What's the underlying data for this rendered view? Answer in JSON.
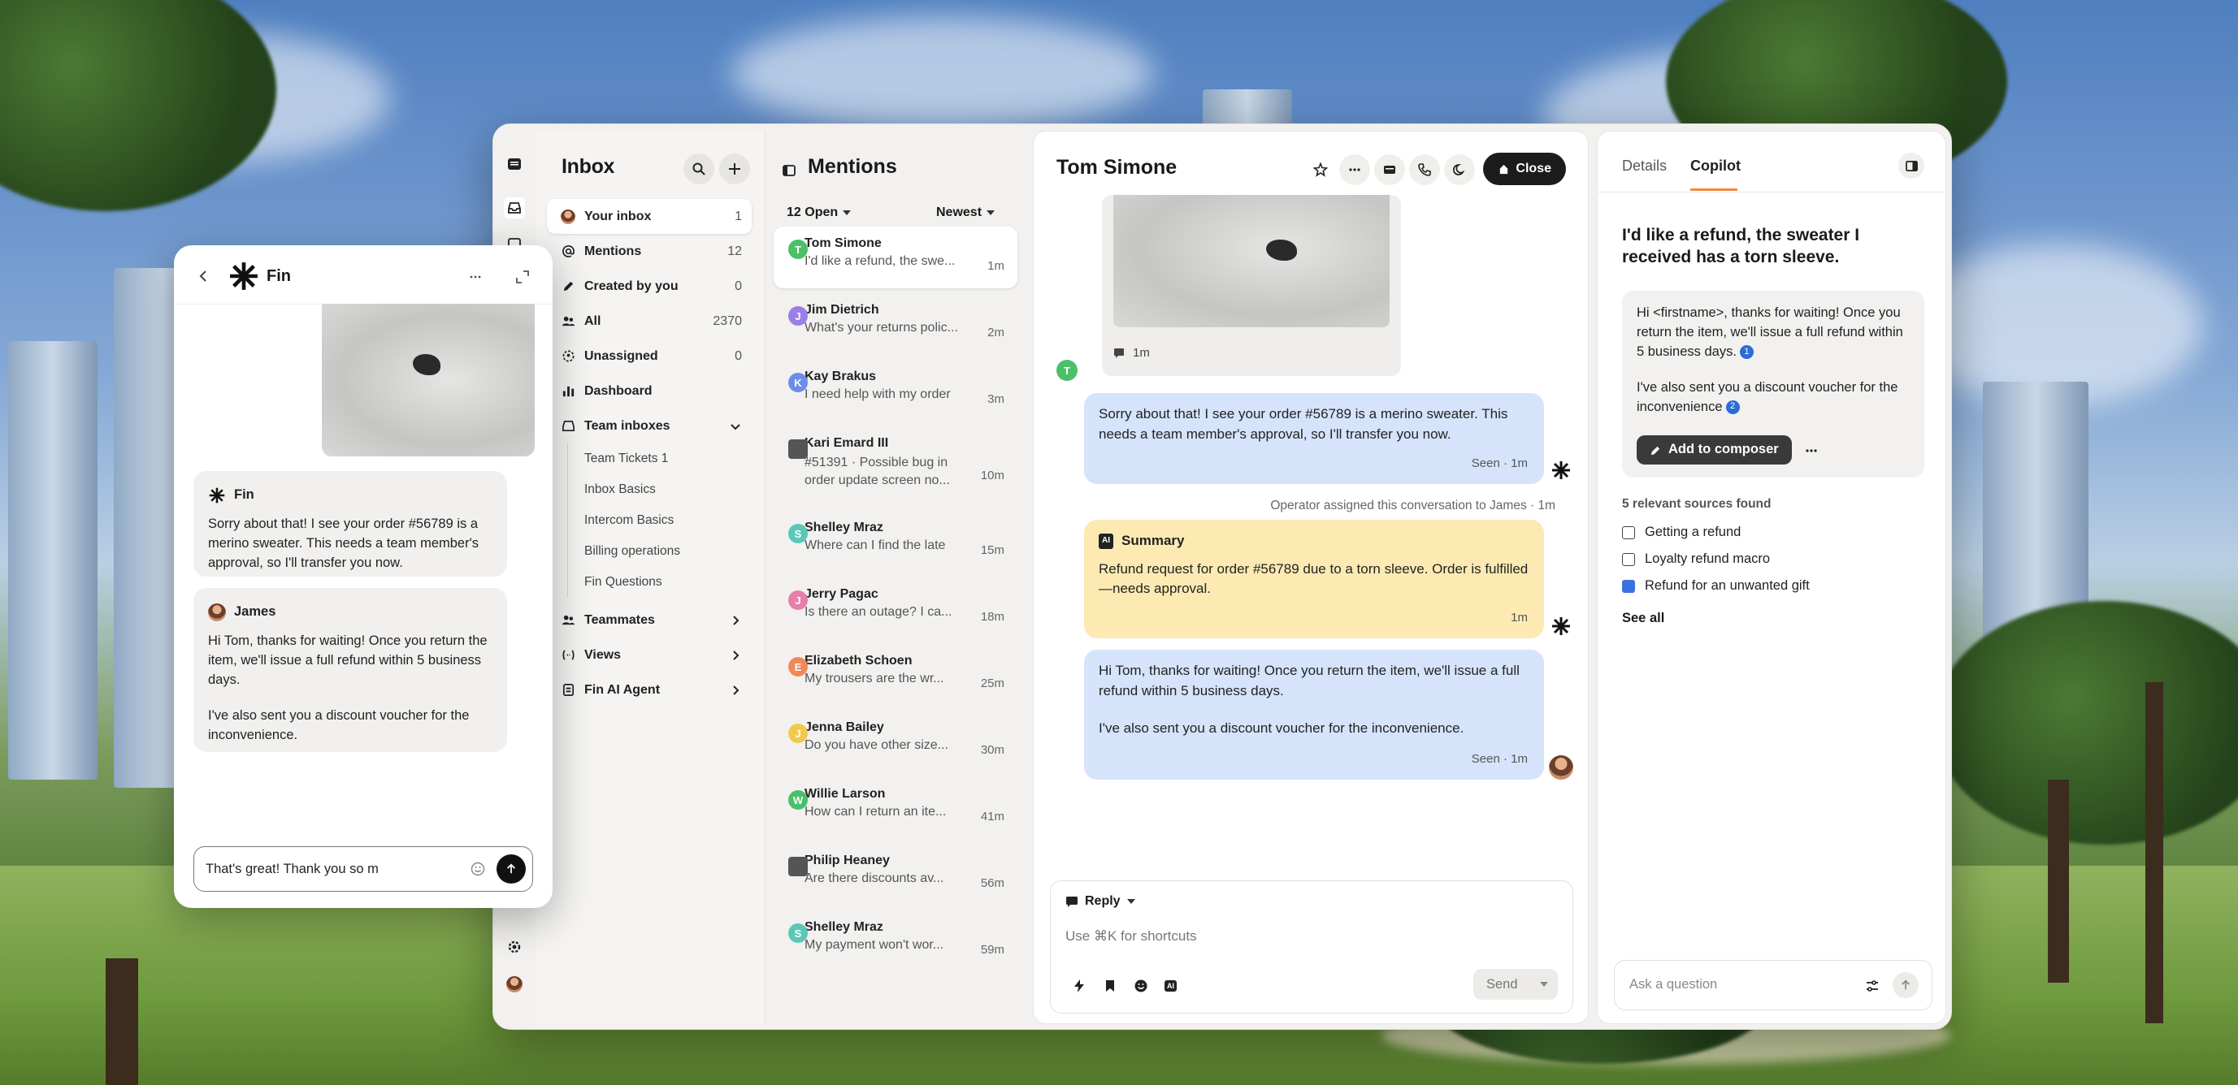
{
  "inbox": {
    "title": "Inbox",
    "nav": [
      {
        "label": "Your inbox",
        "count": "1"
      },
      {
        "label": "Mentions",
        "count": "12"
      },
      {
        "label": "Created by you",
        "count": "0"
      },
      {
        "label": "All",
        "count": "2370"
      },
      {
        "label": "Unassigned",
        "count": "0"
      },
      {
        "label": "Dashboard",
        "count": ""
      }
    ],
    "team_inboxes_label": "Team inboxes",
    "team_inboxes": [
      "Team Tickets 1",
      "Inbox Basics",
      "Intercom Basics",
      "Billing operations",
      "Fin Questions"
    ],
    "teammates_label": "Teammates",
    "views_label": "Views",
    "fin_ai_agent_label": "Fin AI Agent"
  },
  "mentions": {
    "title": "Mentions",
    "filter_status": "12 Open",
    "filter_sort": "Newest",
    "conversations": [
      {
        "initial": "T",
        "name": "Tom Simone",
        "preview": "I'd like a refund, the swe...",
        "time": "1m",
        "color": "#4cbf6a"
      },
      {
        "initial": "J",
        "name": "Jim Dietrich",
        "preview": "What's your returns polic...",
        "time": "2m",
        "color": "#9b7fe6"
      },
      {
        "initial": "K",
        "name": "Kay Brakus",
        "preview": "I need help with my order",
        "time": "3m",
        "color": "#6b8fe6"
      },
      {
        "initial": "",
        "name": "Kari Emard III",
        "preview": "#51391 · Possible bug in order update screen no...",
        "time": "10m",
        "color": "#555555"
      },
      {
        "initial": "S",
        "name": "Shelley Mraz",
        "preview": "Where can I find the late",
        "time": "15m",
        "color": "#5bc8b7"
      },
      {
        "initial": "J",
        "name": "Jerry Pagac",
        "preview": "Is there an outage? I ca...",
        "time": "18m",
        "color": "#e67fa9"
      },
      {
        "initial": "E",
        "name": "Elizabeth Schoen",
        "preview": "My trousers are the wr...",
        "time": "25m",
        "color": "#ef8a58"
      },
      {
        "initial": "J",
        "name": "Jenna Bailey",
        "preview": "Do you have other size...",
        "time": "30m",
        "color": "#f2c94c"
      },
      {
        "initial": "W",
        "name": "Willie Larson",
        "preview": "How can I return an ite...",
        "time": "41m",
        "color": "#4cbf6a"
      },
      {
        "initial": "",
        "name": "Philip Heaney",
        "preview": "Are there discounts av...",
        "time": "56m",
        "color": "#555555"
      },
      {
        "initial": "S",
        "name": "Shelley Mraz",
        "preview": "My payment won't wor...",
        "time": "59m",
        "color": "#5bc8b7"
      }
    ]
  },
  "conversation": {
    "title": "Tom Simone",
    "close_label": "Close",
    "image_time": "1m",
    "avatar_initial": "T",
    "fin_message": "Sorry about that! I see your order #56789 is a merino sweater. This needs a team member's approval, so I'll transfer you now.",
    "fin_message_meta": "Seen · 1m",
    "event": "Operator assigned this conversation to James · 1m",
    "summary_label": "Summary",
    "summary_text": "Refund request for order #56789 due to a torn sleeve. Order is fulfilled—needs approval.",
    "summary_time": "1m",
    "agent_message_1": "Hi Tom, thanks for waiting! Once you return the item, we'll issue a full refund within 5 business days.",
    "agent_message_2": "I've also sent you a discount voucher for the inconvenience.",
    "agent_message_meta": "Seen · 1m",
    "reply_mode": "Reply",
    "reply_placeholder": "Use ⌘K for shortcuts",
    "send_label": "Send"
  },
  "copilot": {
    "tab_details": "Details",
    "tab_copilot": "Copilot",
    "question": "I'd like a refund, the sweater I received has a torn sleeve.",
    "answer_p1": "Hi <firstname>, thanks for waiting! Once you return the item, we'll issue a full refund within 5 business days.",
    "answer_p2": "I've also sent you a discount voucher for the inconvenience",
    "cite1": "1",
    "cite2": "2",
    "add_label": "Add to composer",
    "sources_heading": "5 relevant sources found",
    "sources": [
      "Getting a refund",
      "Loyalty refund macro",
      "Refund for an unwanted gift"
    ],
    "see_all": "See all",
    "ask_placeholder": "Ask a question"
  },
  "widget": {
    "title": "Fin",
    "fin_sender": "Fin",
    "fin_text": "Sorry about that! I see your order #56789 is a merino sweater. This needs a team member's approval, so I'll transfer you now.",
    "agent_sender": "James",
    "agent_text_1": "Hi Tom, thanks for waiting! Once you return the item, we'll issue a full refund within 5 business days.",
    "agent_text_2": "I've also sent you a discount voucher for the inconvenience.",
    "input_value": "That's great! Thank you so m"
  },
  "colors": {
    "accent_blue": "#d5e4fb",
    "summary_yellow": "#fceab2",
    "copilot_tab_underline": "#f08a3c"
  }
}
